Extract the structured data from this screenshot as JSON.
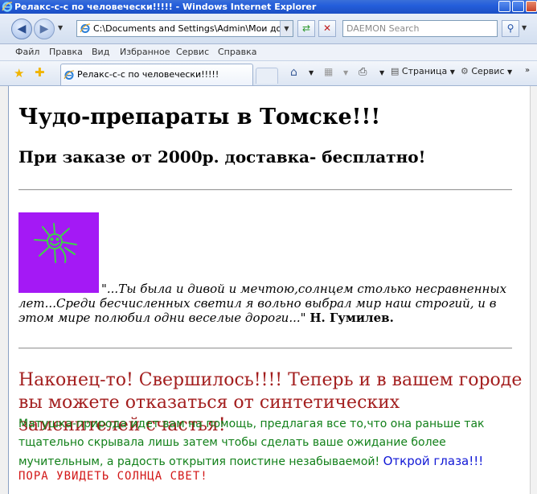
{
  "window": {
    "title": "Релакс-с-с по человечески!!!!! - Windows Internet Explorer"
  },
  "address_bar": {
    "url": "C:\\Documents and Settings\\Admin\\Мои докумен",
    "search_placeholder": "DAEMON Search"
  },
  "menu": {
    "items": [
      "Файл",
      "Правка",
      "Вид",
      "Избранное",
      "Сервис",
      "Справка"
    ]
  },
  "tabs": {
    "active_label": "Релакс-с-с по человечески!!!!!"
  },
  "toolbar": {
    "page_label": "Страница",
    "tools_label": "Сервис"
  },
  "page": {
    "heading": "Чудо-препараты в Томске!!!",
    "subheading": "При заказе от 2000р. доставка- бесплатно!",
    "quote_text": "\"...Ты была и дивой и мечтою,солнцем столько несравненных лет...Среди бесчисленных светил я вольно выбрал мир наш строгий, и в этом мире полюбил одни веселые дороги...\"",
    "quote_author": "Н. Гумилев.",
    "red_paragraph": "Наконец-то! Свершилось!!!! Теперь и в вашем городе вы можете отказаться от синтетических заменителей счастья!",
    "green_paragraph": "Матушка-природа идет вам на помощь, предлагая все то,что она раньше так тщательно скрывала лишь затем чтобы сделать ваше ожидание более мучительным, а радость открытия поистине незабываемой!",
    "blue_link": "Открой глаза!!!",
    "mono_line": "ПОРА УВИДЕТЬ СОЛНЦА СВЕТ!"
  },
  "colors": {
    "sun_background": "#a419f5",
    "sun_stroke": "#3fd14a",
    "red_text": "#a31e1e",
    "green_text": "#12801a",
    "blue_text": "#1118d6",
    "mono_text": "#d21616"
  }
}
